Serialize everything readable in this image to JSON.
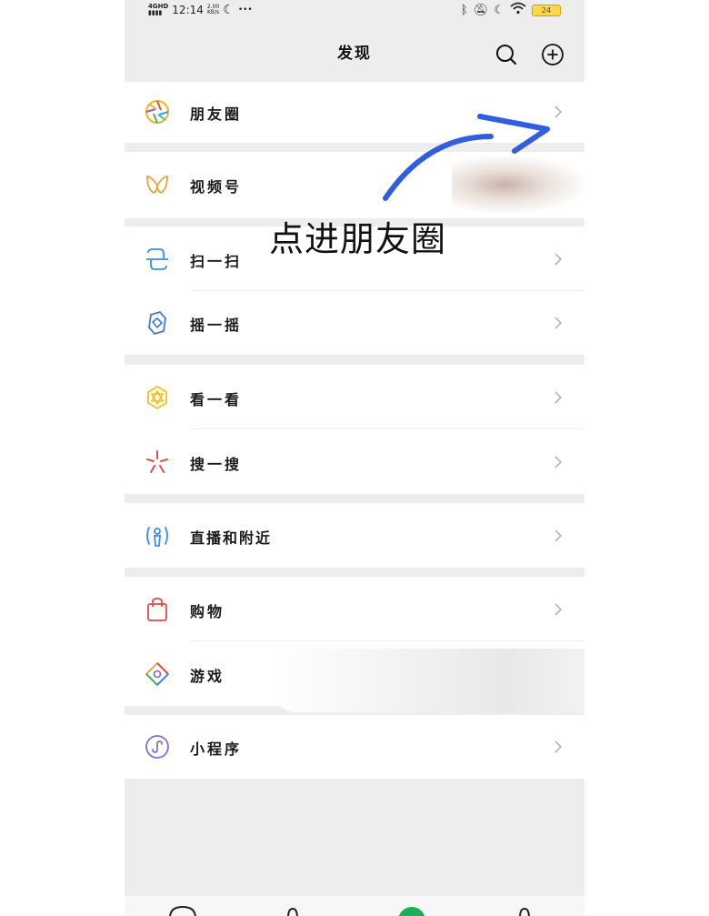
{
  "status": {
    "network": "4GHD",
    "time": "12:14",
    "speed_value": "2.00",
    "speed_unit": "KB/s",
    "more": "•••",
    "battery": "24"
  },
  "nav": {
    "title": "发现"
  },
  "items": [
    {
      "label": "朋友圈",
      "icon": "moments-icon"
    },
    {
      "label": "视频号",
      "icon": "channels-icon"
    },
    {
      "label": "扫一扫",
      "icon": "scan-icon"
    },
    {
      "label": "摇一摇",
      "icon": "shake-icon"
    },
    {
      "label": "看一看",
      "icon": "top-stories-icon"
    },
    {
      "label": "搜一搜",
      "icon": "search-sparkle-icon"
    },
    {
      "label": "直播和附近",
      "icon": "live-nearby-icon"
    },
    {
      "label": "购物",
      "icon": "shopping-bag-icon"
    },
    {
      "label": "游戏",
      "icon": "games-icon"
    },
    {
      "label": "小程序",
      "icon": "mini-programs-icon"
    }
  ],
  "annotation": {
    "text": "点进朋友圈",
    "arrow_color": "#2f5fe0"
  },
  "colors": {
    "page_bg": "#ededed",
    "row_bg": "#ffffff"
  }
}
